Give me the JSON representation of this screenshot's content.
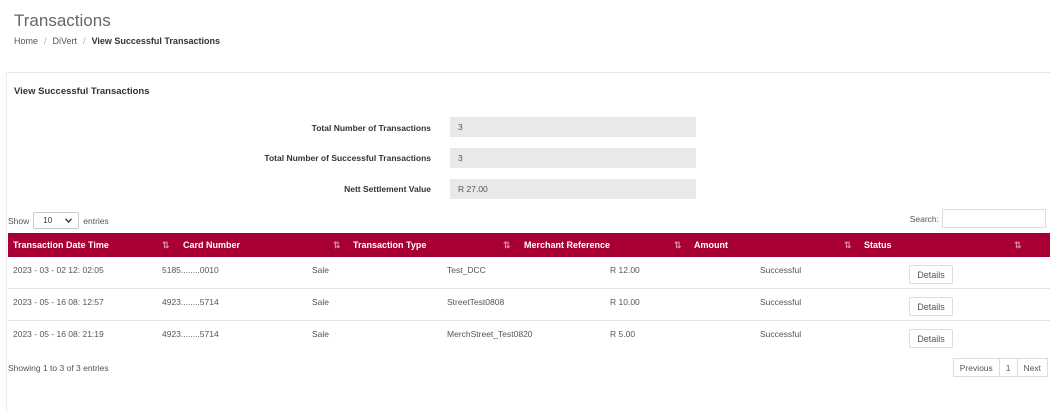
{
  "page": {
    "title": "Transactions"
  },
  "breadcrumb": {
    "home": "Home",
    "divert": "DiVert",
    "current": "View Successful Transactions"
  },
  "card": {
    "title": "View Successful Transactions"
  },
  "summary": {
    "total_label": "Total Number of Transactions",
    "total_value": "3",
    "successful_label": "Total Number of Successful Transactions",
    "successful_value": "3",
    "nett_label": "Nett Settlement Value",
    "nett_value": "R 27.00"
  },
  "length": {
    "show_label": "Show",
    "selected": "10",
    "entries_label": "entries"
  },
  "search": {
    "label": "Search:"
  },
  "table": {
    "headers": [
      "Transaction Date Time",
      "Card Number",
      "Transaction Type",
      "Merchant Reference",
      "Amount",
      "Status"
    ],
    "rows": [
      {
        "date": "2023 - 03 - 02 12: 02:05",
        "card": "5185........0010",
        "type": "Sale",
        "reference": "Test_DCC",
        "amount": "R 12.00",
        "status": "Successful",
        "action": "Details"
      },
      {
        "date": "2023 - 05 - 16 08: 12:57",
        "card": "4923........5714",
        "type": "Sale",
        "reference": "StreetTest0808",
        "amount": "R 10.00",
        "status": "Successful",
        "action": "Details"
      },
      {
        "date": "2023 - 05 - 16 08: 21:19",
        "card": "4923........5714",
        "type": "Sale",
        "reference": "MerchStreet_Test0820",
        "amount": "R 5.00",
        "status": "Successful",
        "action": "Details"
      }
    ]
  },
  "footer": {
    "info": "Showing 1 to 3 of 3 entries",
    "previous": "Previous",
    "page": "1",
    "next": "Next"
  },
  "colors": {
    "header_bg": "#a80034"
  },
  "icons": {
    "sort": "sort-arrows-icon",
    "dropdown": "chevron-down-icon"
  }
}
